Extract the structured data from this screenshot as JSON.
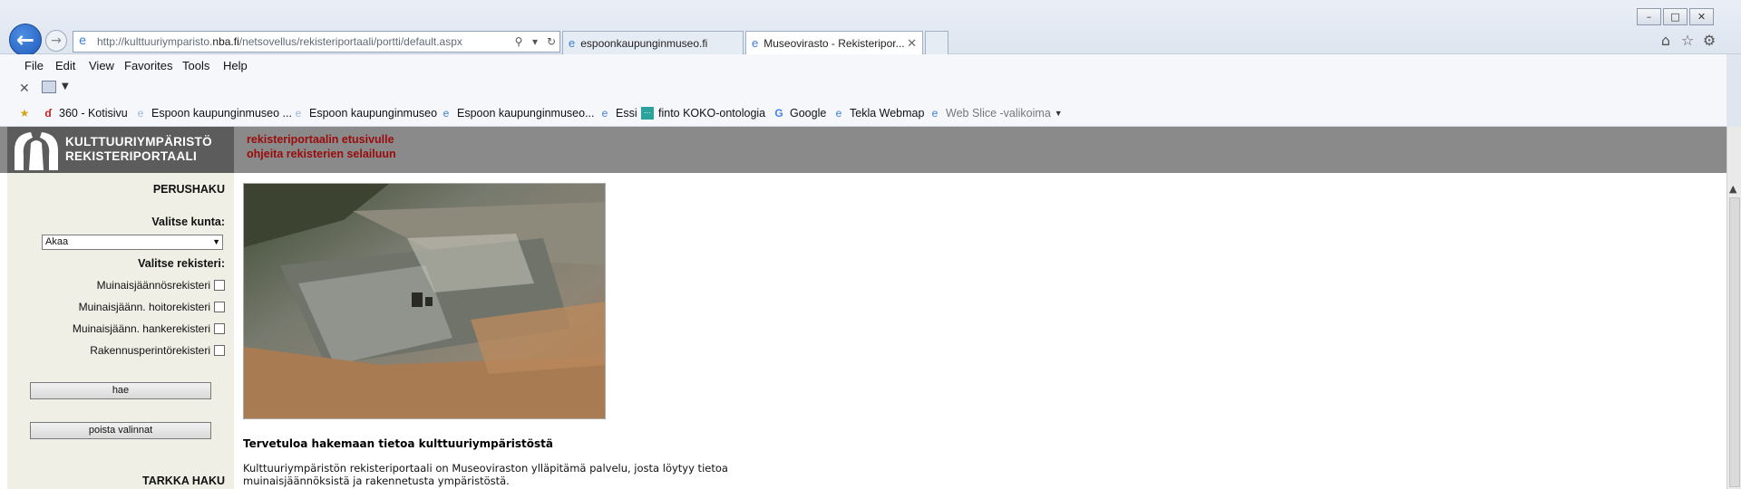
{
  "browser": {
    "url_prefix": "http://kulttuuriymparisto.",
    "url_domain": "nba.fi",
    "url_suffix": "/netsovellus/rekisteriportaali/portti/default.aspx",
    "tabs": [
      {
        "title": "espoonkaupunginmuseo.fi",
        "active": false
      },
      {
        "title": "Museovirasto - Rekisteripor...",
        "active": true
      }
    ],
    "menu": [
      "File",
      "Edit",
      "View",
      "Favorites",
      "Tools",
      "Help"
    ],
    "favorites": [
      "360 - Kotisivu",
      "Espoon kaupunginmuseo ...",
      "Espoon kaupunginmuseo",
      "Espoon kaupunginmuseo...",
      "Essi",
      "finto KOKO-ontologia",
      "Google",
      "Tekla Webmap",
      "Web Slice -valikoima"
    ]
  },
  "page": {
    "logo_line1": "KULTTUURIYMPÄRISTÖ",
    "logo_line2": "REKISTERIPORTAALI",
    "top_links": [
      "rekisteriportaalin etusivulle",
      "ohjeita rekisterien selailuun"
    ],
    "sidebar": {
      "basic_search_title": "PERUSHAKU",
      "select_municipality_label": "Valitse kunta:",
      "municipality_value": "Akaa",
      "select_register_label": "Valitse rekisteri:",
      "registers": [
        "Muinaisjäännösrekisteri",
        "Muinaisjäänn. hoitorekisteri",
        "Muinaisjäänn. hankerekisteri",
        "Rakennusperintörekisteri"
      ],
      "search_button": "hae",
      "clear_button": "poista valinnat",
      "advanced_search_title": "TARKKA HAKU"
    },
    "welcome_title": "Tervetuloa hakemaan tietoa kulttuuriympäristöstä",
    "intro_text": "Kulttuuriympäristön rekisteriportaali on Museoviraston ylläpitämä palvelu, josta löytyy tietoa muinaisjäännöksistä ja rakennetusta ympäristöstä."
  },
  "colors": {
    "header_band": "#8a8a8a",
    "logo_bg": "#5c5c5c",
    "link_red": "#9b0b0b",
    "sidebar_bg": "#efefe6"
  }
}
